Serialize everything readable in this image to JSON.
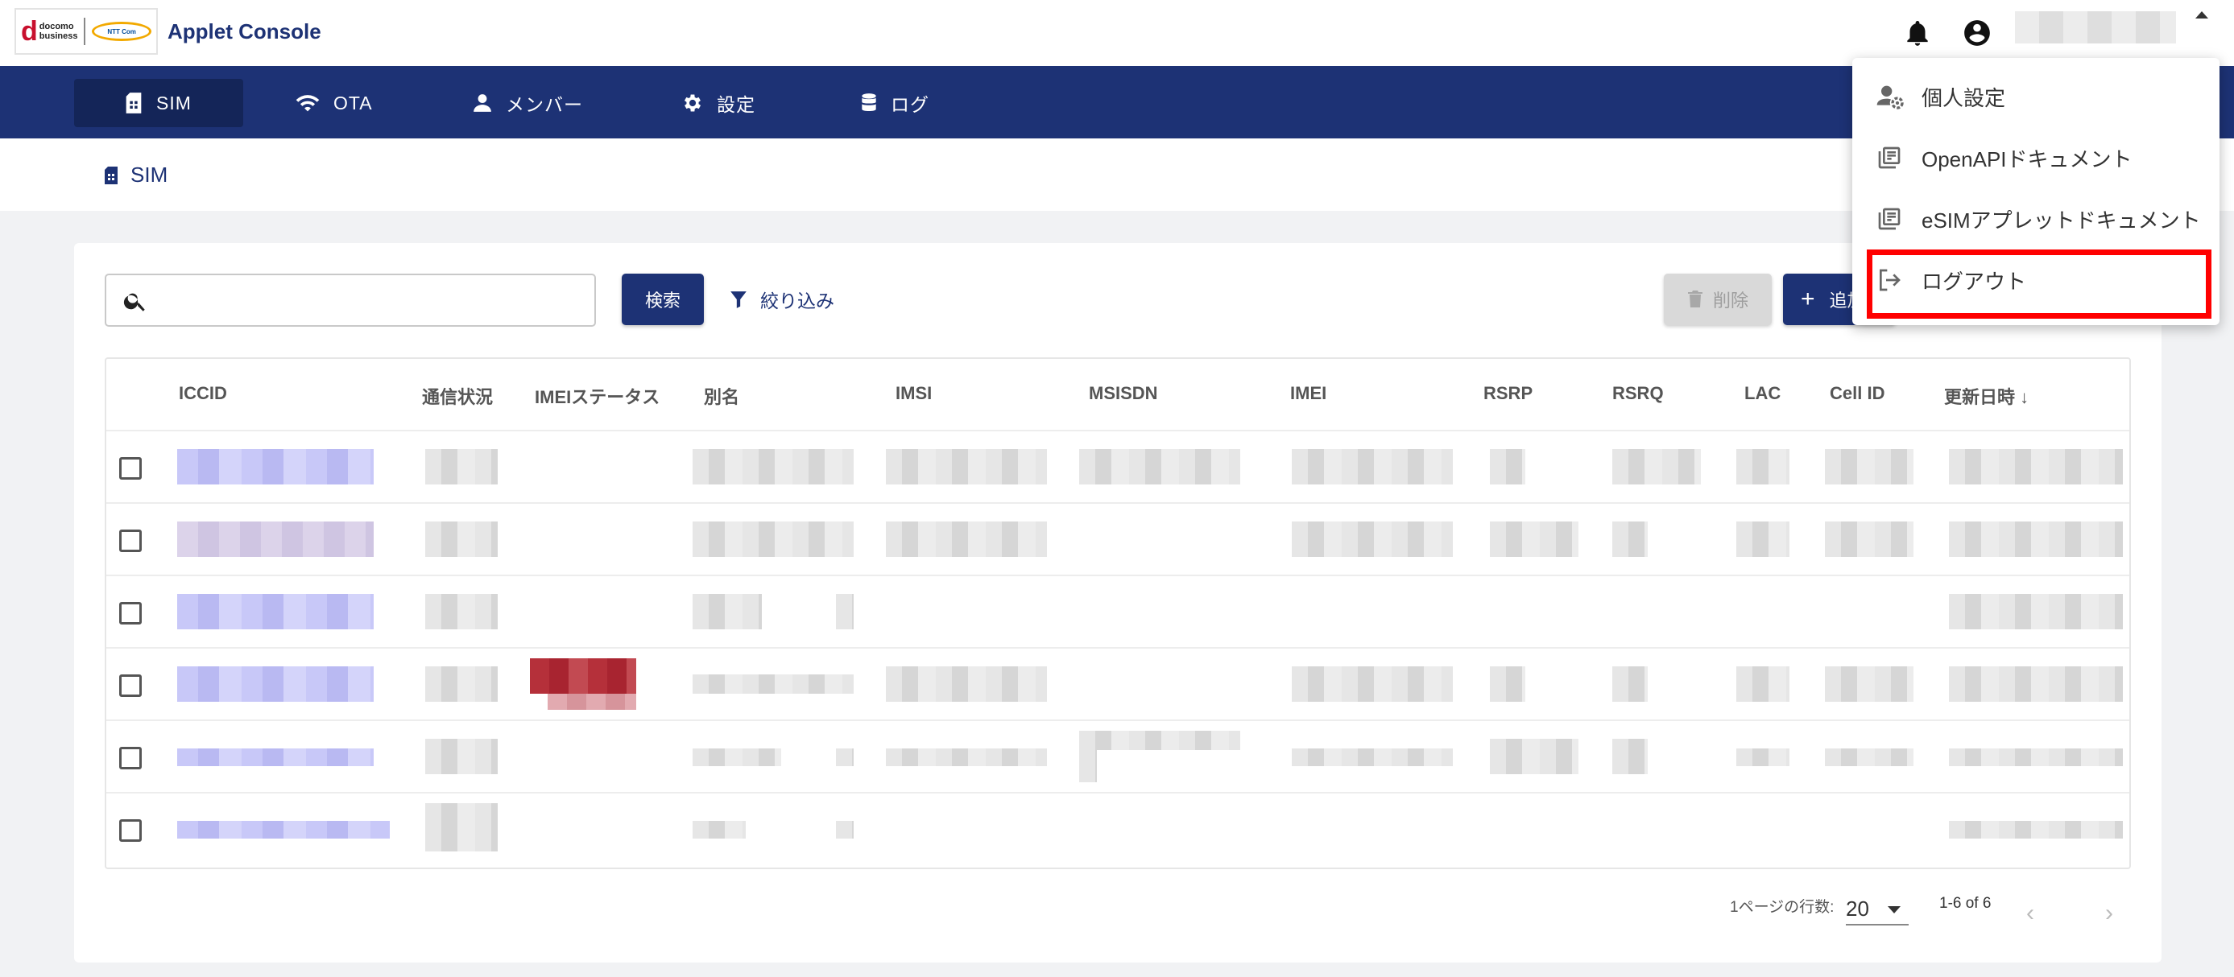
{
  "app": {
    "title": "Applet Console",
    "logo_brand": "docomo business",
    "logo_ntt": "NTT Communications"
  },
  "nav": {
    "items": [
      {
        "label": "SIM",
        "icon": "sim-icon",
        "active": true
      },
      {
        "label": "OTA",
        "icon": "wifi-icon",
        "active": false
      },
      {
        "label": "メンバー",
        "icon": "person-icon",
        "active": false
      },
      {
        "label": "設定",
        "icon": "gear-icon",
        "active": false
      },
      {
        "label": "ログ",
        "icon": "database-icon",
        "active": false
      }
    ]
  },
  "breadcrumb": {
    "label": "SIM"
  },
  "toolbar": {
    "search_placeholder": "",
    "search_button": "検索",
    "filter_button": "絞り込み",
    "delete_button": "削除",
    "add_button": "追加"
  },
  "table": {
    "columns": [
      "ICCID",
      "通信状況",
      "IMEIステータス",
      "別名",
      "IMSI",
      "MSISDN",
      "IMEI",
      "RSRP",
      "RSRQ",
      "LAC",
      "Cell ID",
      "更新日時 ↓"
    ],
    "row_count": 6
  },
  "pagination": {
    "rows_per_page_label": "1ページの行数:",
    "rows_per_page": "20",
    "range": "1-6 of 6"
  },
  "user_menu": {
    "items": [
      {
        "label": "個人設定",
        "icon": "person-settings-icon"
      },
      {
        "label": "OpenAPIドキュメント",
        "icon": "document-library-icon"
      },
      {
        "label": "eSIMアプレットドキュメント",
        "icon": "document-library-icon"
      },
      {
        "label": "ログアウト",
        "icon": "logout-icon",
        "highlighted": true
      }
    ]
  },
  "colors": {
    "primary": "#1d3275",
    "highlight": "#ff0000",
    "background": "#f1f2f4"
  }
}
